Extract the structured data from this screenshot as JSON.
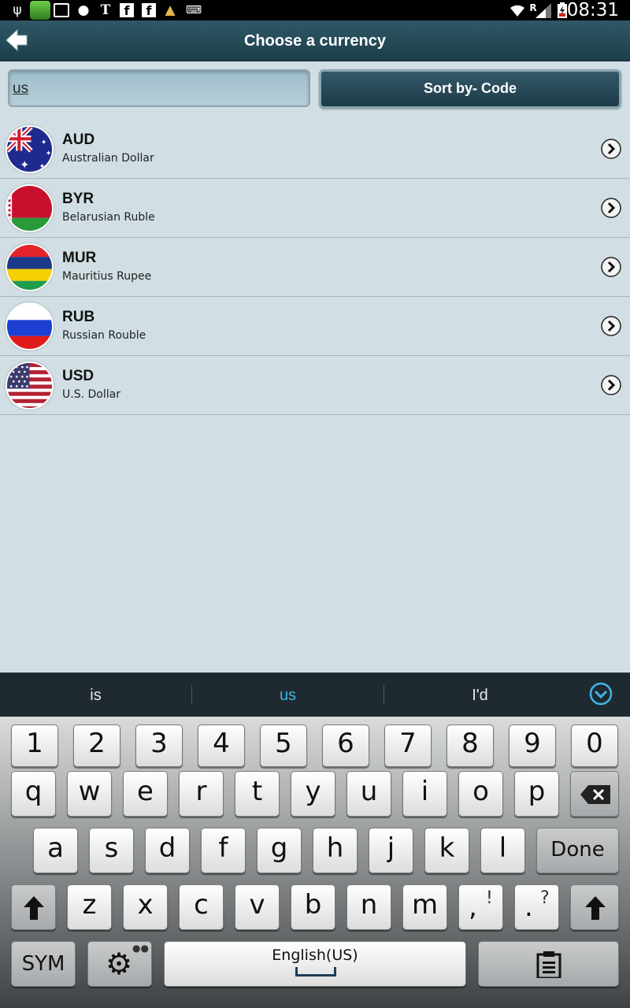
{
  "status_bar": {
    "time": "08:31",
    "left_icons": [
      "usb-icon",
      "app-icon",
      "image-icon",
      "chat-icon",
      "nytimes-icon",
      "facebook-icon",
      "facebook-icon",
      "broom-icon",
      "keyboard-icon"
    ],
    "right_icons": [
      "wifi-icon",
      "roaming-icon",
      "signal-icon",
      "battery-charging-icon"
    ]
  },
  "header": {
    "title": "Choose a currency",
    "back_icon": "back-arrow-icon"
  },
  "search": {
    "value": "us"
  },
  "sort_button": {
    "label": "Sort by- Code"
  },
  "currencies": [
    {
      "code": "AUD",
      "name": "Australian Dollar",
      "flag": "australia-flag-icon"
    },
    {
      "code": "BYR",
      "name": "Belarusian Ruble",
      "flag": "belarus-flag-icon"
    },
    {
      "code": "MUR",
      "name": "Mauritius Rupee",
      "flag": "mauritius-flag-icon"
    },
    {
      "code": "RUB",
      "name": "Russian Rouble",
      "flag": "russia-flag-icon"
    },
    {
      "code": "USD",
      "name": "U.S. Dollar",
      "flag": "usa-flag-icon"
    }
  ],
  "keyboard": {
    "suggestions": [
      "is",
      "us",
      "I'd"
    ],
    "highlighted_suggestion": "us",
    "number_row": [
      "1",
      "2",
      "3",
      "4",
      "5",
      "6",
      "7",
      "8",
      "9",
      "0"
    ],
    "row1": [
      "q",
      "w",
      "e",
      "r",
      "t",
      "y",
      "u",
      "i",
      "o",
      "p"
    ],
    "row2": [
      "a",
      "s",
      "d",
      "f",
      "g",
      "h",
      "j",
      "k",
      "l"
    ],
    "row3": [
      "z",
      "x",
      "c",
      "v",
      "b",
      "n",
      "m"
    ],
    "comma_key": ",",
    "comma_alt": "!",
    "period_key": ".",
    "period_alt": "?",
    "done_label": "Done",
    "sym_label": "SYM",
    "space_label": "English(US)"
  },
  "colors": {
    "header": "#1d3e4b",
    "background": "#d1dfe4",
    "suggestion_highlight": "#3fb6e8"
  }
}
